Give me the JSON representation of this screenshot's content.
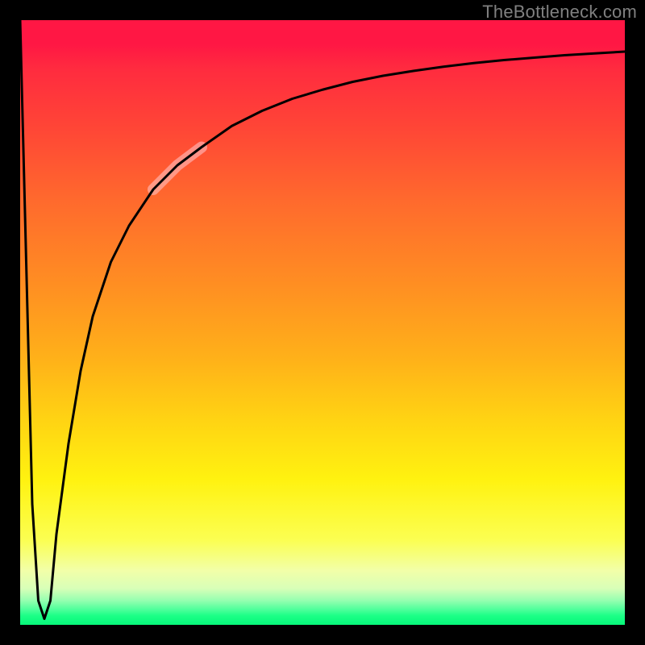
{
  "attribution": "TheBottleneck.com",
  "chart_data": {
    "type": "line",
    "title": "",
    "xlabel": "",
    "ylabel": "",
    "x_range": [
      0,
      100
    ],
    "y_range": [
      0,
      100
    ],
    "grid": false,
    "legend": null,
    "series": [
      {
        "name": "bottleneck-curve",
        "x": [
          0,
          1,
          2,
          3,
          4,
          5,
          6,
          8,
          10,
          12,
          15,
          18,
          22,
          26,
          30,
          35,
          40,
          45,
          50,
          55,
          60,
          65,
          70,
          75,
          80,
          85,
          90,
          95,
          100
        ],
        "y": [
          100,
          60,
          20,
          4,
          1,
          4,
          15,
          30,
          42,
          51,
          60,
          66,
          72,
          76,
          79,
          82.5,
          85,
          87,
          88.5,
          89.8,
          90.8,
          91.6,
          92.3,
          92.9,
          93.4,
          93.8,
          94.2,
          94.5,
          94.8
        ]
      }
    ],
    "highlight_segment": {
      "x_start": 22,
      "x_end": 30
    },
    "background_gradient": {
      "orientation": "vertical",
      "stops": [
        {
          "pos": 0.0,
          "color": "#ff1744"
        },
        {
          "pos": 0.3,
          "color": "#ff6a2d"
        },
        {
          "pos": 0.56,
          "color": "#ffb119"
        },
        {
          "pos": 0.76,
          "color": "#fff210"
        },
        {
          "pos": 0.91,
          "color": "#f2ffa8"
        },
        {
          "pos": 1.0,
          "color": "#07f77a"
        }
      ]
    }
  }
}
